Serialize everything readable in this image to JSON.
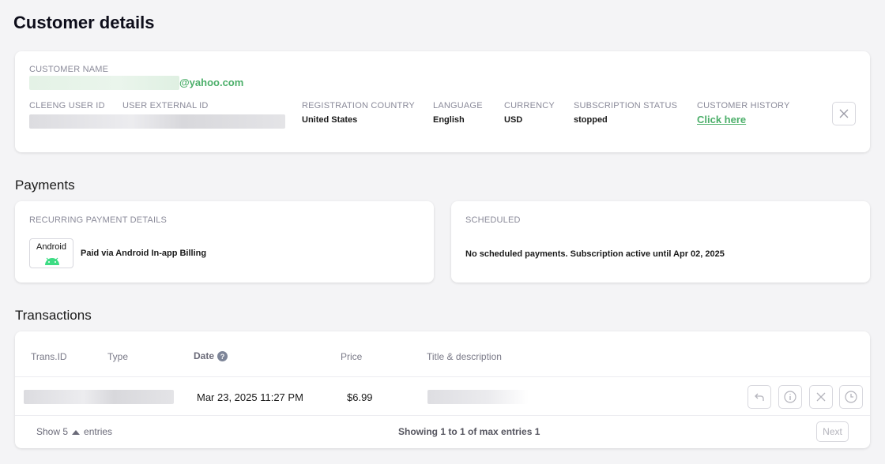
{
  "page": {
    "title": "Customer details"
  },
  "customer": {
    "name_label": "CUSTOMER NAME",
    "email_suffix": "@yahoo.com",
    "cleeng_id_label": "CLEENG USER ID",
    "external_id_label": "USER EXTERNAL ID",
    "country_label": "REGISTRATION COUNTRY",
    "country": "United States",
    "language_label": "LANGUAGE",
    "language": "English",
    "currency_label": "CURRENCY",
    "currency": "USD",
    "status_label": "SUBSCRIPTION STATUS",
    "status": "stopped",
    "history_label": "CUSTOMER HISTORY",
    "history_link": "Click here"
  },
  "payments": {
    "title": "Payments",
    "recurring_label": "RECURRING PAYMENT DETAILS",
    "android_logo_text": "Android",
    "paid_via": "Paid via Android In-app Billing",
    "scheduled_label": "SCHEDULED",
    "scheduled_text": "No scheduled payments. Subscription active until Apr 02, 2025"
  },
  "transactions": {
    "title": "Transactions",
    "columns": [
      "Trans.ID",
      "Type",
      "Date",
      "Price",
      "Title & description"
    ],
    "rows": [
      {
        "date": "Mar 23, 2025 11:27 PM",
        "price": "$6.99"
      }
    ],
    "footer": {
      "show_prefix": "Show 5",
      "show_suffix": "entries",
      "showing": "Showing 1 to 1 of max entries 1",
      "next": "Next"
    }
  },
  "colors": {
    "accent_green": "#4caf6a",
    "muted": "#8a8a99"
  },
  "icons": [
    "close-icon",
    "android-robot-icon",
    "help-circle-icon",
    "undo-icon",
    "info-icon",
    "cancel-icon",
    "clock-icon",
    "caret-up-icon"
  ]
}
